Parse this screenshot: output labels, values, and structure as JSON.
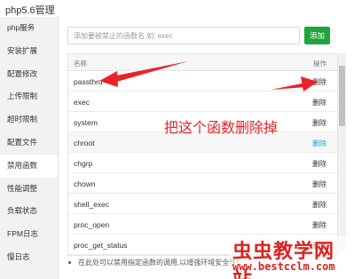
{
  "app": {
    "title": "php5.6管理"
  },
  "sidebar": {
    "items": [
      {
        "label": "php服务"
      },
      {
        "label": "安装扩展"
      },
      {
        "label": "配置修改"
      },
      {
        "label": "上传限制"
      },
      {
        "label": "超时限制"
      },
      {
        "label": "配置文件"
      },
      {
        "label": "禁用函数",
        "active": true
      },
      {
        "label": "性能调整"
      },
      {
        "label": "负载状态"
      },
      {
        "label": "FPM日志"
      },
      {
        "label": "慢日志"
      }
    ]
  },
  "search": {
    "placeholder": "添加要被禁止的函数名,如: exec",
    "value": ""
  },
  "add_button": {
    "label": "添加"
  },
  "table": {
    "headers": {
      "name": "名称",
      "op": "操作"
    },
    "rows": [
      {
        "name": "passthru",
        "action": "删除"
      },
      {
        "name": "exec",
        "action": "删除"
      },
      {
        "name": "system",
        "action": "删除"
      },
      {
        "name": "chroot",
        "action": "删除"
      },
      {
        "name": "chgrp",
        "action": "删除"
      },
      {
        "name": "chown",
        "action": "删除"
      },
      {
        "name": "shell_exec",
        "action": "删除"
      },
      {
        "name": "proc_open",
        "action": "删除"
      },
      {
        "name": "proc_get_status",
        "action": "删除"
      }
    ]
  },
  "note": {
    "text": "在此处可以禁用指定函数的调用,以增强环境安全性!"
  },
  "annotation": {
    "text": "把这个函数删除掉",
    "color": "#e8232a"
  },
  "watermark": {
    "title": "虫虫教学网站",
    "url": "www.bestcclm.com",
    "color": "#e02020"
  },
  "colors": {
    "accent": "#20a53a",
    "link": "#20a0c8"
  }
}
